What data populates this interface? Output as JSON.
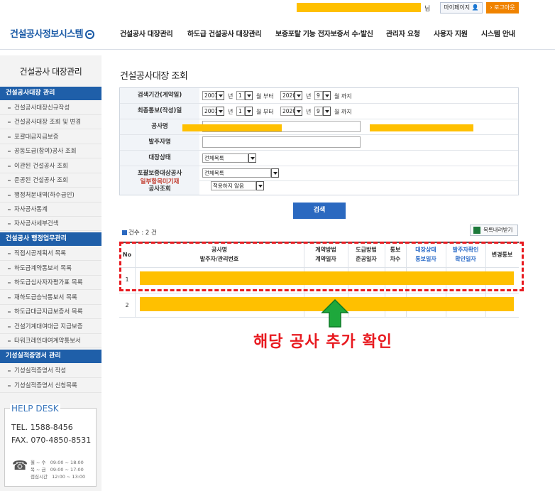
{
  "topbar": {
    "user_suffix": "님",
    "mypage": "마이페이지",
    "logout": "로그아웃"
  },
  "header": {
    "logo": "건설공사정보시스템",
    "nav": [
      "건설공사 대장관리",
      "하도급 건설공사 대장관리",
      "보증포탈 기능 전자보증서 수·발신",
      "관리자 요청",
      "사용자 지원",
      "시스템 안내"
    ]
  },
  "sidebar": {
    "title": "건설공사 대장관리",
    "section1": "건설공사대장 관리",
    "items1": [
      "건설공사대장신규작성",
      "건설공사대장 조회 및 변경",
      "포괄대금지급보증",
      "공동도급(참여)공사 조회",
      "이관된 건설공사 조회",
      "준공된 건설공사 조회",
      "행정처분내역(하수급인)",
      "자사공사통계",
      "자사공사세부건색"
    ],
    "section2": "건설공사 행정업무관리",
    "items2": [
      "직접시공계획서 목록",
      "하도급계약통보서 목록",
      "하도급심사자자평가표 목록",
      "재하도급승낙통보서 목록",
      "하도급대금지급보증서 목록",
      "건설기계대여대금 지급보증",
      "타워크레인대여계약통보서"
    ],
    "section3": "기성실적증명서 관리",
    "items3": [
      "기성실적증명서 작성",
      "기성실적증명서 신청목록"
    ],
    "helpdesk": {
      "title": "HELP DESK",
      "tel": "TEL. 1588-8456",
      "fax": "FAX. 070-4850-8531",
      "hours": [
        {
          "label": "월 ~ 수",
          "time": "09:00 ~ 18:00"
        },
        {
          "label": "목 ~ 금",
          "time": "09:00 ~ 17:00"
        },
        {
          "label": "점심시간",
          "time": "12:00 ~ 13:00"
        }
      ]
    }
  },
  "main": {
    "title": "건설공사대장 조회",
    "search": {
      "period_label": "검색기간(계약일)",
      "notify_label": "최종통보(작성)일",
      "from_year": "2001",
      "from_month": "1",
      "to_year": "2020",
      "to_month": "9",
      "unit_year": "년",
      "unit_month_from": "월 부터",
      "unit_month_to": "월 까지",
      "project_label": "공사명",
      "client_label": "발주자명",
      "status_label": "대장상태",
      "status_value": "전체목록",
      "guarantee_label": "포괄보증대상공사",
      "guarantee_value": "전체목록",
      "unregistered_label_1": "일부항목미기재",
      "unregistered_label_2": "공사조회",
      "unregistered_value": "적용하지 않음",
      "button": "검색"
    },
    "count_label": "건수 : 2 건",
    "download": "목록내려받기",
    "table": {
      "headers": [
        [
          "No"
        ],
        [
          "공사명",
          "발주자/관리번호"
        ],
        [
          "계약방법",
          "계약일자"
        ],
        [
          "도급방법",
          "준공일자"
        ],
        [
          "통보",
          "차수"
        ],
        [
          "대장상태",
          "통보일자"
        ],
        [
          "발주자확인",
          "확인일자"
        ],
        [
          "변경통보"
        ]
      ],
      "rows": [
        "1",
        "2"
      ]
    },
    "annotation": "해당 공사 추가 확인"
  }
}
